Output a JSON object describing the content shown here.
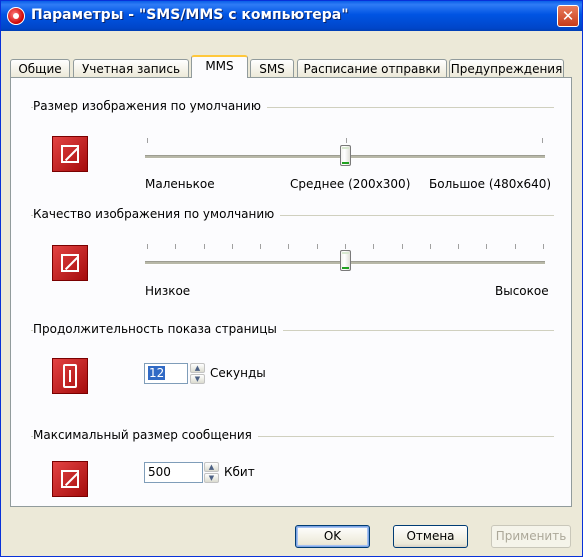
{
  "window": {
    "title": "Параметры - \"SMS/MMS с компьютера\"",
    "close_glyph": "✕"
  },
  "tabs": [
    {
      "label": "Общие"
    },
    {
      "label": "Учетная запись"
    },
    {
      "label": "MMS",
      "active": true
    },
    {
      "label": "SMS"
    },
    {
      "label": "Расписание отправки"
    },
    {
      "label": "Предупреждения"
    }
  ],
  "image_size": {
    "group_label": "Размер изображения по умолчанию",
    "icon": "resize-image-icon",
    "min_label": "Маленькое",
    "mid_label": "Среднее (200x300)",
    "max_label": "Большое (480x640)",
    "position": 0.5
  },
  "image_quality": {
    "group_label": "Качество изображения по умолчанию",
    "icon": "image-quality-icon",
    "min_label": "Низкое",
    "max_label": "Высокое",
    "position": 0.5
  },
  "page_duration": {
    "group_label": "Продолжительность показа страницы",
    "icon": "timer-icon",
    "value": "12",
    "unit": "Секунды"
  },
  "max_size": {
    "group_label": "Максимальный размер сообщения",
    "icon": "message-size-icon",
    "value": "500",
    "unit": "Кбит"
  },
  "buttons": {
    "ok": "OK",
    "cancel": "Отмена",
    "apply": "Применить"
  },
  "colors": {
    "accent_red": "#c00000",
    "titlebar_blue": "#0054e3",
    "selection_blue": "#316ac5"
  }
}
